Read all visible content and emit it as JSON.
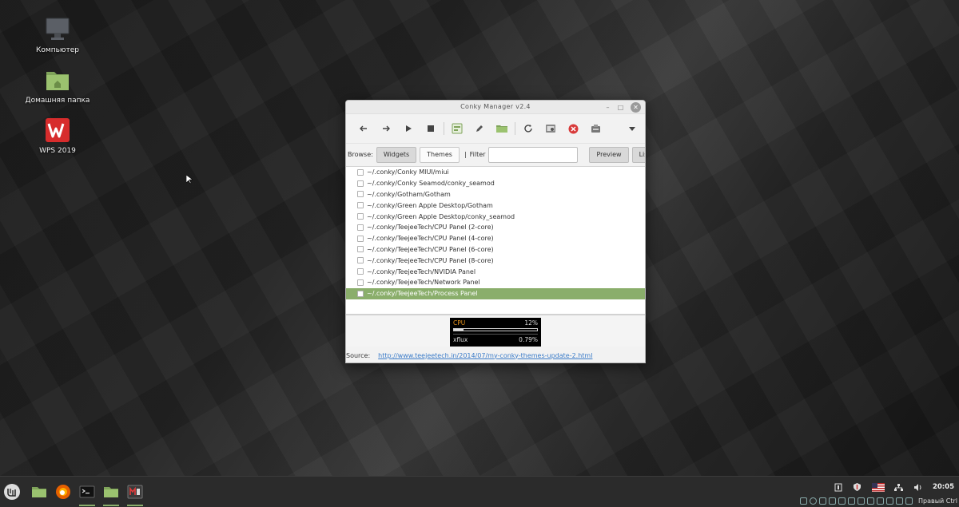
{
  "desktop": {
    "icons": [
      {
        "label": "Компьютер"
      },
      {
        "label": "Домашняя папка"
      },
      {
        "label": "WPS 2019"
      }
    ]
  },
  "window": {
    "title": "Conky Manager v2.4",
    "controls": {
      "minimize": "–",
      "maximize": "□",
      "close": "✕"
    }
  },
  "toolbar": {
    "icons": [
      "back-icon",
      "forward-icon",
      "play-icon",
      "stop-icon",
      "edit-widget-icon",
      "pencil-icon",
      "folder-icon",
      "refresh-icon",
      "settings-icon",
      "kill-icon",
      "donate-icon",
      "menu-icon"
    ]
  },
  "browse": {
    "label": "Browse:",
    "widgets": "Widgets",
    "themes": "Themes",
    "separator": "|",
    "filter_label": "Filter",
    "filter_value": "",
    "preview": "Preview",
    "list": "List"
  },
  "items": [
    {
      "path": "~/.conky/Conky MIUI/miui",
      "selected": false
    },
    {
      "path": "~/.conky/Conky Seamod/conky_seamod",
      "selected": false
    },
    {
      "path": "~/.conky/Gotham/Gotham",
      "selected": false
    },
    {
      "path": "~/.conky/Green Apple Desktop/Gotham",
      "selected": false
    },
    {
      "path": "~/.conky/Green Apple Desktop/conky_seamod",
      "selected": false
    },
    {
      "path": "~/.conky/TeejeeTech/CPU Panel (2-core)",
      "selected": false
    },
    {
      "path": "~/.conky/TeejeeTech/CPU Panel (4-core)",
      "selected": false
    },
    {
      "path": "~/.conky/TeejeeTech/CPU Panel (6-core)",
      "selected": false
    },
    {
      "path": "~/.conky/TeejeeTech/CPU Panel (8-core)",
      "selected": false
    },
    {
      "path": "~/.conky/TeejeeTech/NVIDIA Panel",
      "selected": false
    },
    {
      "path": "~/.conky/TeejeeTech/Network Panel",
      "selected": false
    },
    {
      "path": "~/.conky/TeejeeTech/Process Panel",
      "selected": true
    }
  ],
  "preview_widget": {
    "cpu_label": "CPU",
    "cpu_value": "12%",
    "cpu_fraction": 0.12,
    "proc_name": "xflux",
    "proc_value": "0.79%"
  },
  "source": {
    "label": "Source:",
    "url": "http://www.teejeetech.in/2014/07/my-conky-themes-update-2.html"
  },
  "taskbar": {
    "clock": "20:05",
    "keyboard_layout": "Правый Ctrl",
    "accent": "#8aae6b"
  }
}
